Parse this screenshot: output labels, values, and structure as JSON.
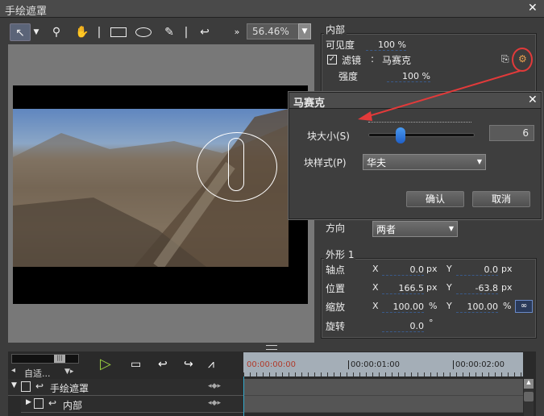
{
  "window": {
    "title": "手绘遮罩",
    "close": "✕"
  },
  "toolbar": {
    "tools": [
      "select-arrow",
      "dropdown",
      "magnifier",
      "hand",
      "separator",
      "rectangle",
      "ellipse",
      "pen",
      "separator",
      "undo",
      "more"
    ],
    "zoom": "56.46%"
  },
  "inner": {
    "group_label": "内部",
    "visibility_label": "可见度",
    "visibility_value": "100 %",
    "filter_checked": true,
    "filter_label": "滤镜",
    "filter_colon": ":",
    "filter_name": "马赛克",
    "strength_label": "强度",
    "strength_value": "100 %"
  },
  "direction": {
    "label": "方向",
    "value": "两者"
  },
  "shape": {
    "group_label": "外形 1",
    "pivot_label": "轴点",
    "position_label": "位置",
    "scale_label": "缩放",
    "rotation_label": "旋转",
    "x": "X",
    "y": "Y",
    "pivot_x": "0.0",
    "pivot_y": "0.0",
    "pos_x": "166.5",
    "pos_y": "-63.8",
    "scale_x": "100.00",
    "scale_y": "100.00",
    "rotation": "0.0",
    "px": "px",
    "pct": "%",
    "deg": "°"
  },
  "dialog": {
    "title": "马赛克",
    "close": "✕",
    "block_size_label": "块大小(S)",
    "block_size_value": "6",
    "block_size_slider_fraction": 0.3,
    "block_style_label": "块样式(P)",
    "block_style_value": "华夫",
    "ok": "确认",
    "cancel": "取消"
  },
  "timeline": {
    "fit_label": "自适...",
    "timecodes": [
      "00:00:00:00",
      "00:00:01:00",
      "00:00:02:00"
    ],
    "tracks": [
      {
        "name": "手绘遮罩"
      },
      {
        "name": "内部"
      }
    ]
  },
  "colors": {
    "accent_red": "#e23a3a",
    "timecode_red": "#b03a2a",
    "slider_blue": "#1f6fd8"
  }
}
